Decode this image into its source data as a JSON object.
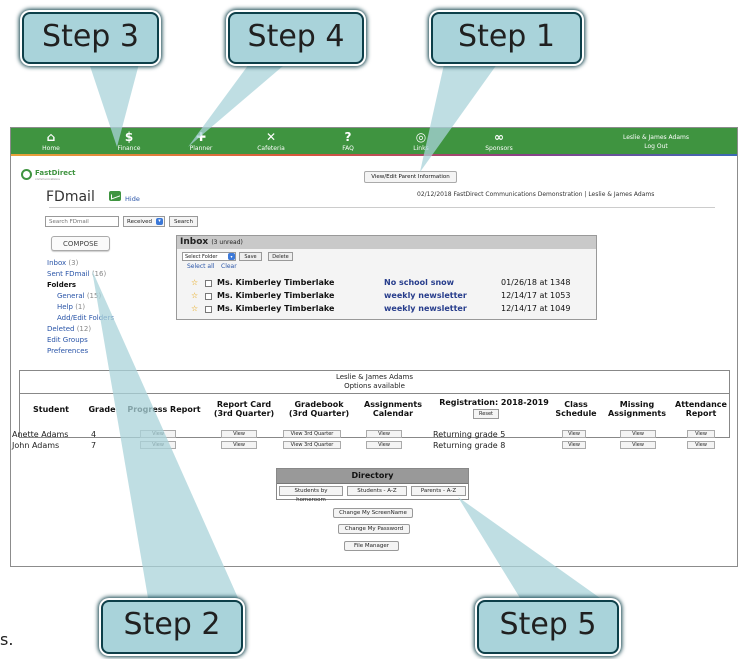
{
  "nav": {
    "items": [
      {
        "label": "Home",
        "icon": "home-icon",
        "glyph": "⌂"
      },
      {
        "label": "Finance",
        "icon": "dollar-icon",
        "glyph": "$"
      },
      {
        "label": "Planner",
        "icon": "pin-icon",
        "glyph": "✚"
      },
      {
        "label": "Cafeteria",
        "icon": "utensils-icon",
        "glyph": "✕"
      },
      {
        "label": "FAQ",
        "icon": "question-icon",
        "glyph": "?"
      },
      {
        "label": "Links",
        "icon": "globe-icon",
        "glyph": "◎"
      },
      {
        "label": "Sponsors",
        "icon": "handshake-icon",
        "glyph": "∞"
      }
    ],
    "user_name": "Leslie & James Adams",
    "logout": "Log Out"
  },
  "header": {
    "logo_text": "FastDirect",
    "logo_sub": "communications",
    "view_parent_label": "View/Edit Parent Information",
    "title": "FDmail",
    "hide_label": "Hide",
    "info": "02/12/2018  FastDirect Communications Demonstration | Leslie & James Adams"
  },
  "search": {
    "placeholder": "Search FDmail",
    "filter_value": "Received",
    "button_label": "Search"
  },
  "sidebar": {
    "compose": "COMPOSE",
    "inbox": "Inbox",
    "inbox_count": "(3)",
    "sent": "Sent FDmail",
    "sent_count": "(16)",
    "folders": "Folders",
    "general": "General",
    "general_count": "(15)",
    "help": "Help",
    "help_count": "(1)",
    "add_edit": "Add/Edit Folders",
    "deleted": "Deleted",
    "deleted_count": "(12)",
    "edit_groups": "Edit Groups",
    "preferences": "Preferences"
  },
  "inbox": {
    "title": "Inbox",
    "unread": "(3 unread)",
    "select_folder": "Select Folder",
    "save": "Save",
    "delete": "Delete",
    "select_all": "Select all",
    "clear": "Clear",
    "messages": [
      {
        "from": "Ms. Kimberley Timberlake",
        "subject": "No school snow",
        "date": "01/26/18 at 1348"
      },
      {
        "from": "Ms. Kimberley Timberlake",
        "subject": "weekly newsletter",
        "date": "12/14/17 at 1053"
      },
      {
        "from": "Ms. Kimberley Timberlake",
        "subject": "weekly newsletter",
        "date": "12/14/17 at 1049"
      }
    ]
  },
  "options": {
    "family": "Leslie & James Adams",
    "subtitle": "Options available",
    "columns": {
      "student": "Student",
      "grade": "Grade",
      "progress": "Progress Report",
      "report_card": "Report Card\n(3rd Quarter)",
      "gradebook": "Gradebook\n(3rd Quarter)",
      "assignments": "Assignments\nCalendar",
      "registration": "Registration: 2018-2019",
      "schedule": "Class\nSchedule",
      "missing": "Missing\nAssignments",
      "attendance": "Attendance\nReport"
    },
    "reset": "Reset",
    "view": "View",
    "view_3rd": "View 3rd Quarter",
    "students": [
      {
        "name": "Anette Adams",
        "grade": "4",
        "registration": "Returning grade 5"
      },
      {
        "name": "John Adams",
        "grade": "7",
        "registration": "Returning grade 8"
      }
    ]
  },
  "directory": {
    "title": "Directory",
    "by_homeroom": "Students by homeroom",
    "students_az": "Students - A-Z",
    "parents_az": "Parents - A-Z",
    "change_screenname": "Change My ScreenName",
    "change_password": "Change My Password",
    "file_manager": "File Manager"
  },
  "callouts": {
    "step1": "Step 1",
    "step2": "Step 2",
    "step3": "Step 3",
    "step4": "Step 4",
    "step5": "Step 5"
  },
  "stray_text": "s."
}
